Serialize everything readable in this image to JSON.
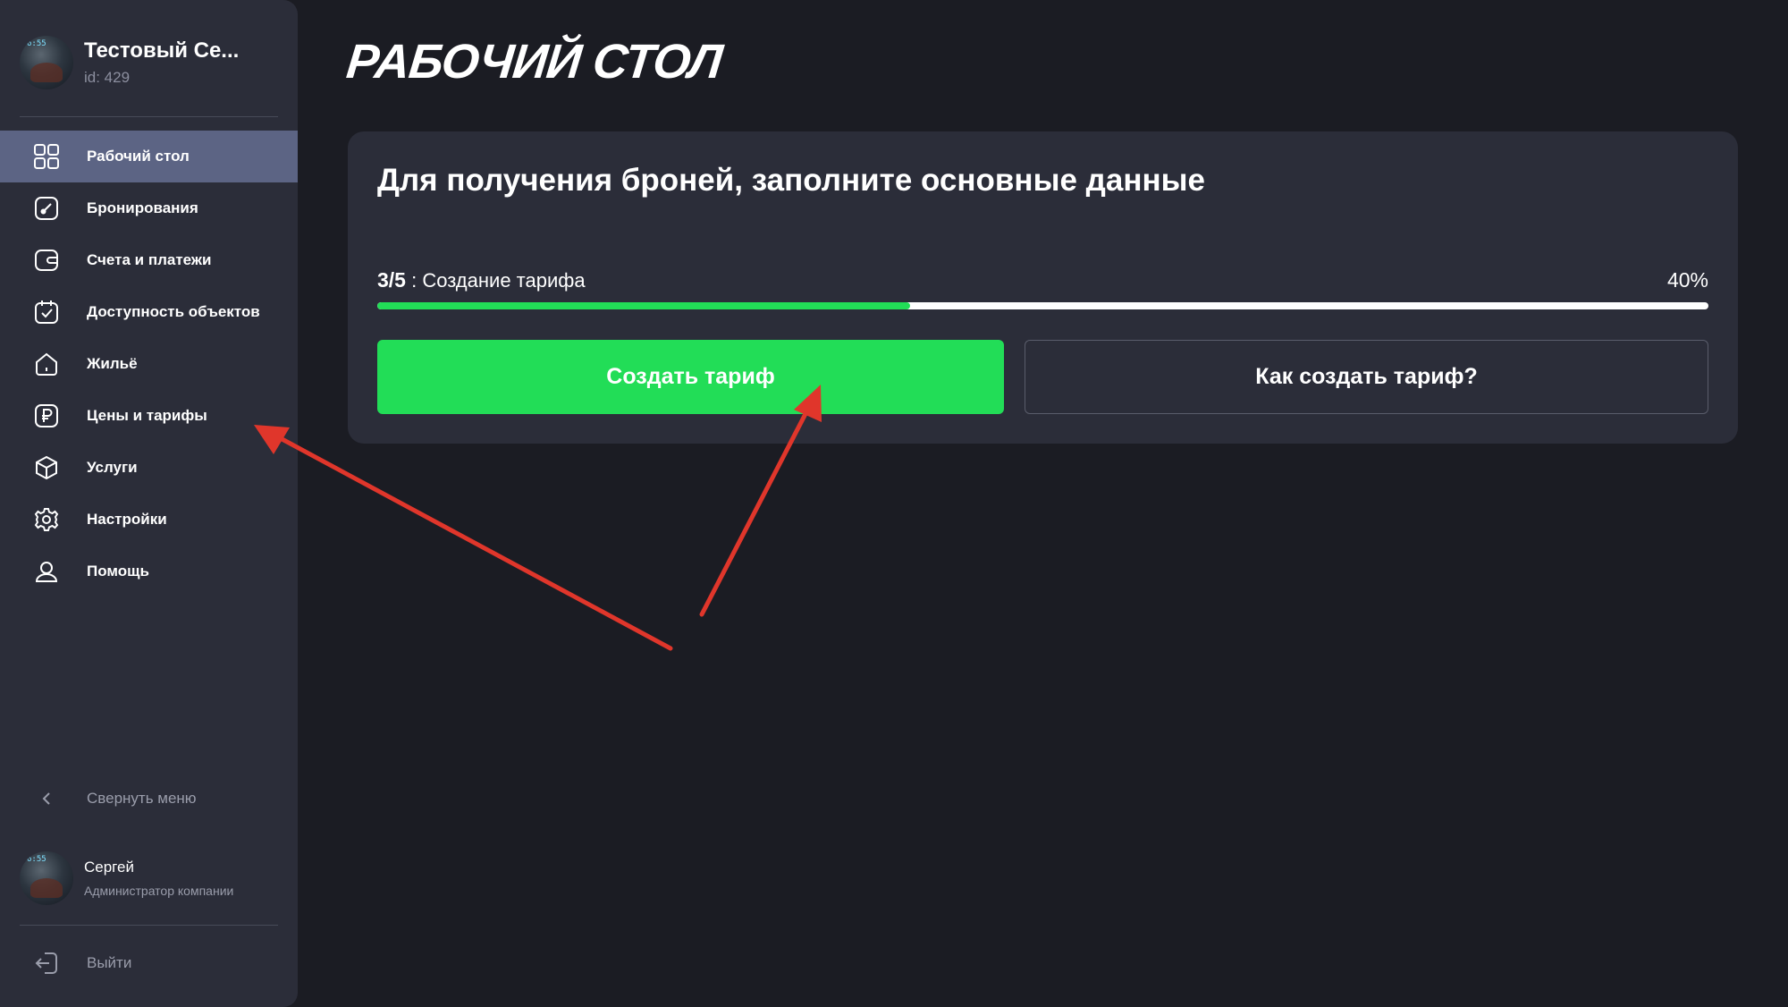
{
  "company": {
    "name": "Тестовый Се...",
    "id": "id: 429"
  },
  "sidebar": {
    "items": [
      {
        "label": "Рабочий стол",
        "icon": "grid-icon",
        "active": true
      },
      {
        "label": "Бронирования",
        "icon": "edit-square-icon"
      },
      {
        "label": "Счета и платежи",
        "icon": "wallet-icon"
      },
      {
        "label": "Доступность объектов",
        "icon": "calendar-check-icon"
      },
      {
        "label": "Жильё",
        "icon": "home-icon"
      },
      {
        "label": "Цены и тарифы",
        "icon": "ruble-icon"
      },
      {
        "label": "Услуги",
        "icon": "box-icon"
      },
      {
        "label": "Настройки",
        "icon": "gear-icon"
      },
      {
        "label": "Помощь",
        "icon": "user-help-icon"
      }
    ],
    "collapse_label": "Свернуть меню",
    "logout_label": "Выйти"
  },
  "user": {
    "name": "Сергей",
    "role": "Администратор компании"
  },
  "main": {
    "title": "РАБОЧИЙ СТОЛ",
    "card": {
      "title": "Для получения броней, заполните основные данные",
      "step_number": "3/5",
      "step_separator": " : ",
      "step_label": "Создание тарифа",
      "progress_percent_label": "40%",
      "progress_value": 0.4,
      "primary_button": "Создать тариф",
      "secondary_button": "Как создать тариф?"
    }
  },
  "colors": {
    "background": "#1b1c23",
    "sidebar": "#2b2d39",
    "active_item": "#5c6484",
    "accent_green": "#22dd57",
    "annotation_red": "#e0362b"
  }
}
